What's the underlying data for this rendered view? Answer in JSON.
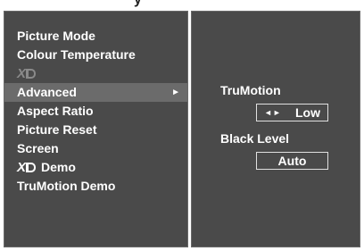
{
  "title": "y",
  "menu": {
    "items": [
      {
        "label": "Picture Mode"
      },
      {
        "label": "Colour Temperature"
      },
      {
        "label": "XD"
      },
      {
        "label": "Advanced",
        "arrow": "►"
      },
      {
        "label": "Aspect Ratio"
      },
      {
        "label": "Picture Reset"
      },
      {
        "label": "Screen"
      },
      {
        "label": "XD",
        "suffix": "Demo"
      },
      {
        "label": "TruMotion Demo"
      }
    ],
    "selected_index": 3
  },
  "advanced": {
    "trumotion_label": "TruMotion",
    "trumotion_arrows": "◄►",
    "trumotion_value": "Low",
    "black_level_label": "Black Level",
    "black_level_value": "Auto"
  },
  "colors": {
    "panel_bg": "#4a4a4a",
    "selected_bg": "#6b6b6b",
    "text": "#ffffff",
    "disabled_text": "#8a8a8a"
  }
}
